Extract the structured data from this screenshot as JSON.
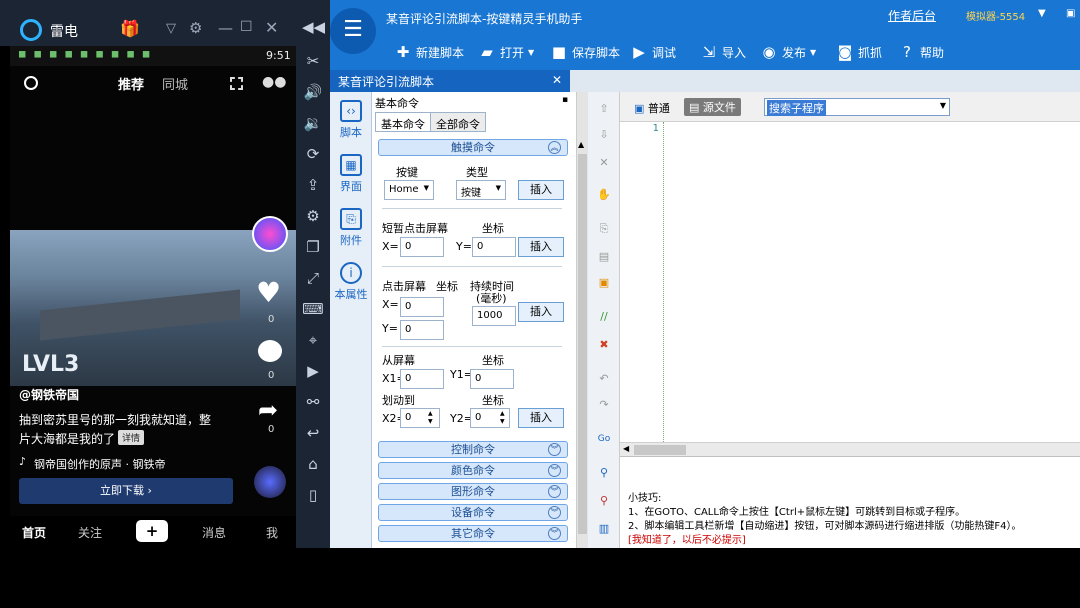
{
  "emulator": {
    "title": "雷电",
    "clock": "9:51",
    "sidebar_icons": [
      "scissors-icon",
      "volume-up-icon",
      "volume-down-icon",
      "rotate-icon",
      "apk-install-icon",
      "robot-icon",
      "multi-window-icon",
      "fullscreen-icon",
      "keyboard-icon",
      "location-icon",
      "record-icon",
      "shake-icon",
      "back-icon",
      "home-icon",
      "recent-apps-icon"
    ]
  },
  "phone": {
    "top_tabs": {
      "recommend": "推荐",
      "local": "同城"
    },
    "video_badge": "LVL3",
    "author": "@钢铁帝国",
    "caption_line1": "抽到密苏里号的那一刻我就知道，整",
    "caption_line2": "片大海都是我的了",
    "detail_tag": "详情",
    "music": "钢帝国创作的原声 · 钢铁帝",
    "download_button": "立即下载",
    "like_count": "0",
    "comment_count": "0",
    "share_count": "0",
    "bottom_nav": {
      "home": "首页",
      "follow": "关注",
      "plus": "+",
      "messages": "消息",
      "me": "我"
    }
  },
  "app": {
    "window_title": "某音评论引流脚本-按键精灵手机助手",
    "top_link": "作者后台",
    "simulator": "模拟器-5554",
    "toolbar": {
      "new": "新建脚本",
      "open": "打开",
      "save": "保存脚本",
      "debug": "调试",
      "import": "导入",
      "publish": "发布",
      "capture": "抓抓",
      "help": "帮助"
    },
    "doc_tab": "某音评论引流脚本",
    "left_nav": {
      "script": "脚本",
      "ui": "界面",
      "attach": "附件",
      "props": "本属性"
    },
    "panel_title": "基本命令",
    "panel_tabs": {
      "basic": "基本命令",
      "all": "全部命令"
    },
    "groups": {
      "touch": "触摸命令",
      "control": "控制命令",
      "color": "颜色命令",
      "graphic": "图形命令",
      "device": "设备命令",
      "other": "其它命令"
    },
    "touch": {
      "key_label": "按键",
      "type_label": "类型",
      "key_value": "Home",
      "type_value": "按键",
      "insert": "插入",
      "tap_label": "短暂点击屏幕",
      "coord_label": "坐标",
      "x_label": "X=",
      "y_label": "Y=",
      "x_value": "0",
      "y_value": "0",
      "press_label": "点击屏幕",
      "duration_label": "持续时间",
      "duration_unit": "(毫秒)",
      "duration_value": "1000",
      "from_label": "从屏幕",
      "x1_label": "X1=",
      "y1_label": "Y1=",
      "swipe_to_label": "划动到",
      "x2_label": "X2=",
      "y2_label": "Y2="
    },
    "editor": {
      "mode_normal": "普通",
      "mode_source": "源文件",
      "search_placeholder": "搜索子程序",
      "line_number": "1"
    },
    "tips": {
      "title": "小技巧:",
      "tip1": "1、在GOTO、CALL命令上按住【Ctrl+鼠标左键】可跳转到目标或子程序。",
      "tip2": "2、脚本编辑工具栏新增【自动缩进】按钮，可对脚本源码进行缩进排版（功能热键F4）。",
      "dismiss": "[我知道了，以后不必提示]"
    },
    "colors": {
      "toolbar_blue": "#1976d2",
      "accent": "#1565c0",
      "tip_red": "#cc0000"
    }
  }
}
